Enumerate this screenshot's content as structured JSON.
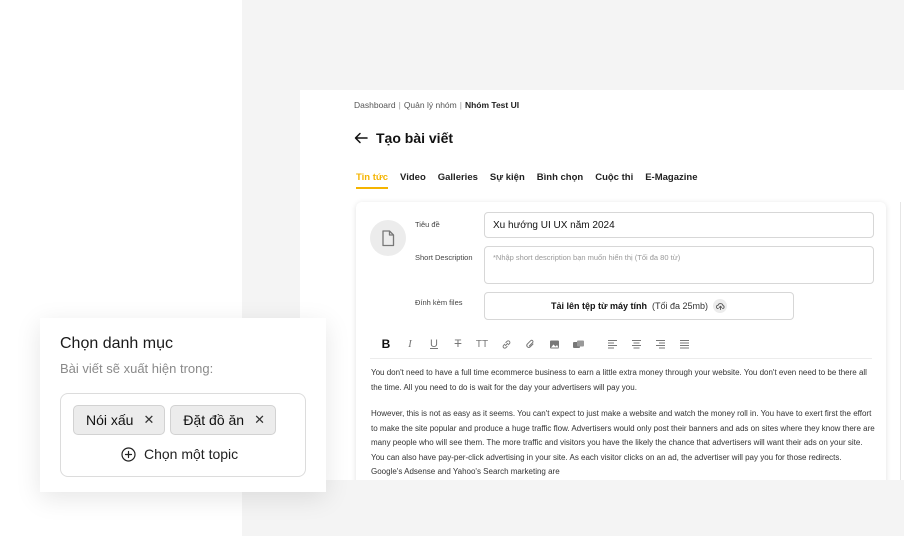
{
  "breadcrumb": {
    "items": [
      "Dashboard",
      "Quản lý nhóm",
      "Nhóm Test UI"
    ],
    "separator": "|"
  },
  "page": {
    "title": "Tạo bài viết"
  },
  "tabs": [
    {
      "label": "Tin tức",
      "active": true
    },
    {
      "label": "Video"
    },
    {
      "label": "Galleries"
    },
    {
      "label": "Sự kiện"
    },
    {
      "label": "Bình chọn"
    },
    {
      "label": "Cuộc thi"
    },
    {
      "label": "E-Magazine"
    }
  ],
  "form": {
    "title_label": "Tiêu đề",
    "title_value": "Xu hướng UI UX năm 2024",
    "desc_label": "Short Description",
    "desc_placeholder": "*Nhập short description bạn muốn hiển thị (Tối đa 80 từ)",
    "attach_label": "Đính kèm files",
    "upload_label": "Tải lên tệp từ máy tính",
    "upload_hint": "(Tối đa 25mb)"
  },
  "toolbar": {
    "tools": [
      "bold",
      "italic",
      "underline",
      "strikethrough",
      "text-size",
      "link",
      "attachment",
      "image",
      "gallery",
      "align-left",
      "align-center",
      "align-right",
      "align-justify"
    ]
  },
  "content": {
    "paragraphs": [
      "You don't need to have a full time ecommerce business to earn a little extra money through your website. You don't even need to be there all the time. All you need to do is wait for the day your advertisers will pay you.",
      "However, this is not as easy as it seems. You can't expect to just make a website and watch the money roll in. You have to exert first the effort to make the site popular and produce a huge traffic flow. Advertisers would only post their banners and ads on sites where they know there are many people who will see them. The more traffic and visitors you have the likely the chance that advertisers will want their ads on your site. You can also have pay-per-click advertising in your site. As each visitor clicks on an ad, the advertiser will pay you for those redirects. Google's Adsense and Yahoo's Search marketing are"
    ]
  },
  "category": {
    "title": "Chọn danh mục",
    "subtitle": "Bài viết sẽ xuất hiện trong:",
    "chips": [
      "Nói xấu",
      "Đặt đồ ăn"
    ],
    "remove_symbol": "✕",
    "add_label": "Chọn một topic"
  },
  "colors": {
    "accent": "#f5b400",
    "background_panel": "#f4f4f4"
  }
}
